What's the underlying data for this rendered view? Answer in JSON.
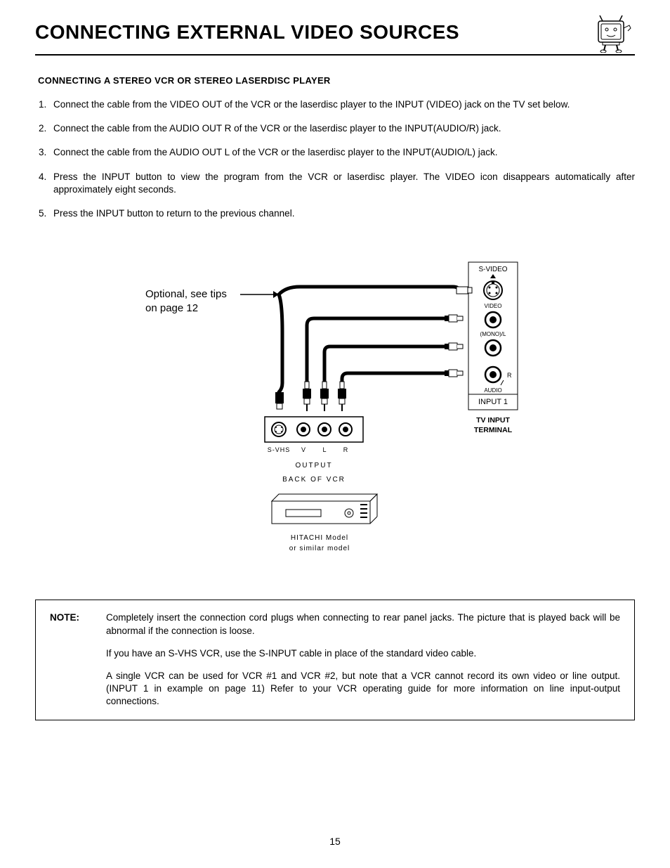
{
  "title": "CONNECTING EXTERNAL VIDEO SOURCES",
  "section_heading": "CONNECTING A STEREO VCR OR STEREO LASERDISC PLAYER",
  "steps": [
    "Connect the cable from the VIDEO OUT of the VCR or the laserdisc player to the INPUT (VIDEO) jack on the TV set below.",
    "Connect the cable from the AUDIO OUT R of the VCR or the laserdisc player to the INPUT(AUDIO/R) jack.",
    "Connect the cable from the AUDIO OUT L of the VCR or the laserdisc player to the INPUT(AUDIO/L) jack.",
    "Press the INPUT button to view the program from the VCR or laserdisc player.  The VIDEO icon disappears automatically after approximately eight seconds.",
    "Press the INPUT button to return to the previous channel."
  ],
  "diagram": {
    "tip_line1": "Optional, see tips",
    "tip_line2": "on page 12",
    "tv_svideo": "S-VIDEO",
    "tv_video": "VIDEO",
    "tv_mono_l": "(MONO)/L",
    "tv_r": "R",
    "tv_audio": "AUDIO",
    "tv_input1": "INPUT 1",
    "tv_terminal_l1": "TV INPUT",
    "tv_terminal_l2": "TERMINAL",
    "vcr_svhs": "S-VHS",
    "vcr_v": "V",
    "vcr_l": "L",
    "vcr_r": "R",
    "vcr_output": "OUTPUT",
    "vcr_back": "BACK OF VCR",
    "vcr_model_l1": "HITACHI Model",
    "vcr_model_l2": "or similar model"
  },
  "note": {
    "label": "NOTE:",
    "p1": "Completely insert the connection cord plugs when connecting to rear panel jacks.  The picture that is played back will be abnormal if the connection is loose.",
    "p2": "If you have an S-VHS VCR, use the S-INPUT cable in place of the standard video cable.",
    "p3": "A single VCR can be used for VCR #1 and VCR #2, but note that a VCR cannot record its own video or line output.  (INPUT 1 in example on page 11)  Refer to your VCR operating guide for more information on line input-output connections."
  },
  "page_number": "15"
}
